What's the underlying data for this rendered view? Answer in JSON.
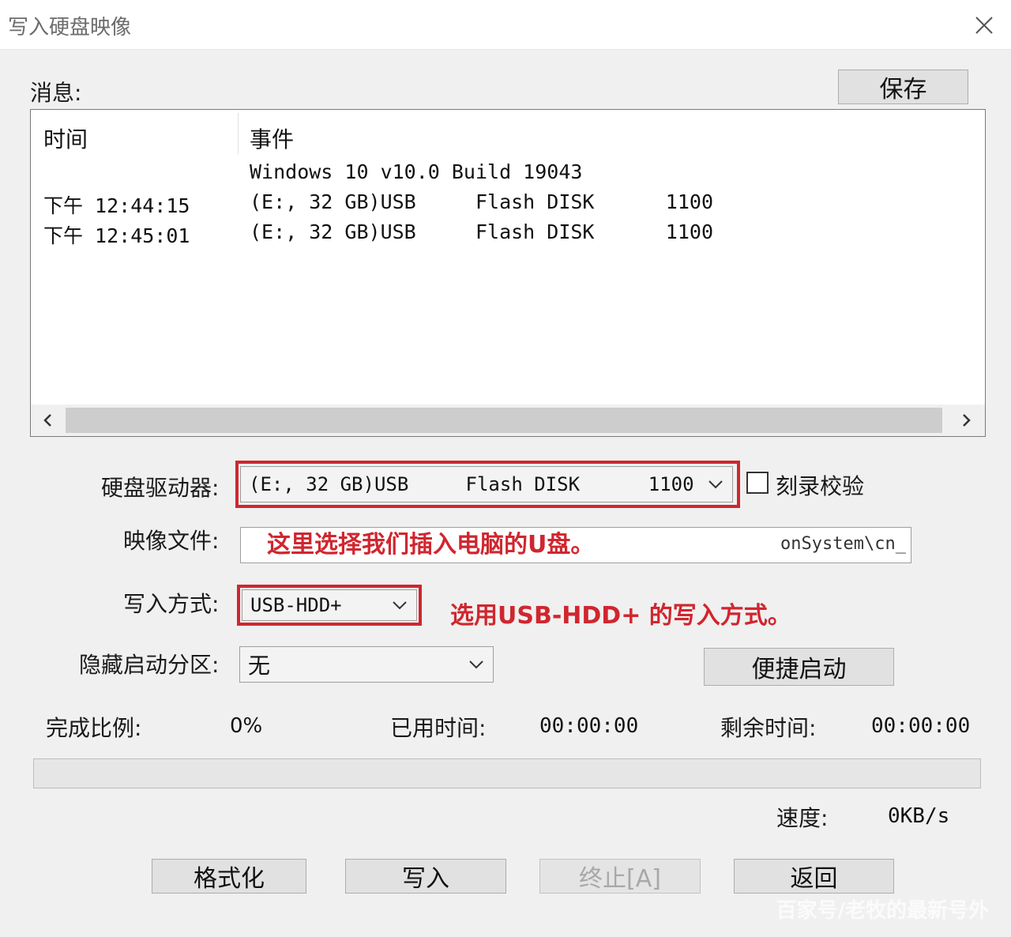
{
  "window": {
    "title": "写入硬盘映像",
    "close_icon": "close-icon"
  },
  "messages": {
    "label": "消息:",
    "save_button": "保存",
    "columns": {
      "time": "时间",
      "event": "事件"
    },
    "rows": [
      {
        "time": "",
        "event": "Windows 10 v10.0 Build 19043"
      },
      {
        "time": "下午 12:44:15",
        "event": "(E:, 32 GB)USB     Flash DISK      1100"
      },
      {
        "time": "下午 12:45:01",
        "event": "(E:, 32 GB)USB     Flash DISK      1100"
      }
    ]
  },
  "drive": {
    "label": "硬盘驱动器:",
    "value": "(E:, 32 GB)USB     Flash DISK      1100",
    "verify_label": "刻录校验",
    "verify_checked": false
  },
  "image_file": {
    "label": "映像文件:",
    "annotation": "这里选择我们插入电脑的U盘。",
    "value_visible": "onSystem\\cn_"
  },
  "write_mode": {
    "label": "写入方式:",
    "value": "USB-HDD+",
    "annotation": "选用USB-HDD+ 的写入方式。"
  },
  "hidden_partition": {
    "label": "隐藏启动分区:",
    "value": "无",
    "quick_boot_button": "便捷启动"
  },
  "status": {
    "progress_label": "完成比例:",
    "progress_value": "0%",
    "progress_fraction": 0,
    "elapsed_label": "已用时间:",
    "elapsed_value": "00:00:00",
    "remaining_label": "剩余时间:",
    "remaining_value": "00:00:00",
    "speed_label": "速度:",
    "speed_value": "0KB/s"
  },
  "actions": {
    "format": "格式化",
    "write": "写入",
    "stop": "终止[A]",
    "back": "返回"
  },
  "watermark": "百家号/老牧的最新号外",
  "colors": {
    "annotation_red": "#d0262f",
    "button_bg": "#e1e1e1",
    "window_bg": "#f0f0f0"
  }
}
